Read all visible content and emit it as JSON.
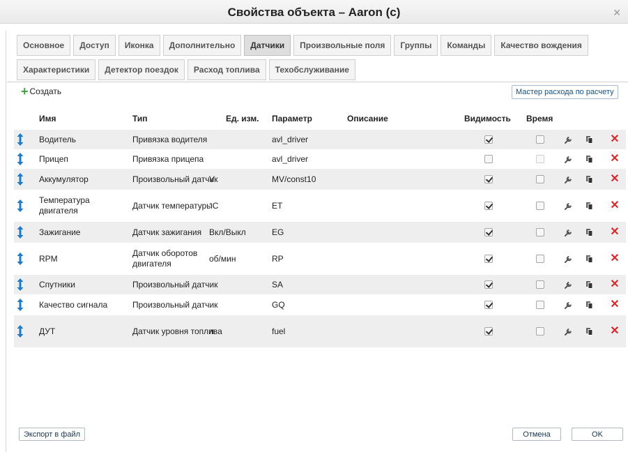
{
  "dialog": {
    "title": "Свойства объекта – Aaron (c)"
  },
  "tabs_row1": [
    "Основное",
    "Доступ",
    "Иконка",
    "Дополнительно",
    "Датчики",
    "Произвольные поля",
    "Группы",
    "Команды",
    "Качество вождения"
  ],
  "tabs_row2": [
    "Характеристики",
    "Детектор поездок",
    "Расход топлива",
    "Техобслуживание"
  ],
  "active_tab": "Датчики",
  "toolbar": {
    "create_label": "Создать",
    "wizard_label": "Мастер расхода по расчету"
  },
  "table": {
    "headers": {
      "name": "Имя",
      "type": "Тип",
      "unit": "Ед. изм.",
      "param": "Параметр",
      "desc": "Описание",
      "visibility": "Видимость",
      "time": "Время"
    },
    "rows": [
      {
        "name": "Водитель",
        "type": "Привязка водителя",
        "unit": "",
        "param": "avl_driver",
        "desc": "",
        "visible": true,
        "time": false,
        "time_disabled": false
      },
      {
        "name": "Прицеп",
        "type": "Привязка прицепа",
        "unit": "",
        "param": "avl_driver",
        "desc": "",
        "visible": false,
        "time": false,
        "time_disabled": true
      },
      {
        "name": "Аккумулятор",
        "type": "Произвольный датчик",
        "unit": "V",
        "param": "MV/const10",
        "desc": "",
        "visible": true,
        "time": false,
        "time_disabled": false
      },
      {
        "name": "Температура двигателя",
        "type": "Датчик температуры",
        "unit": "°C",
        "param": "ET",
        "desc": "",
        "visible": true,
        "time": false,
        "time_disabled": false
      },
      {
        "name": "Зажигание",
        "type": "Датчик зажигания",
        "unit": "Вкл/Выкл",
        "param": "EG",
        "desc": "",
        "visible": true,
        "time": false,
        "time_disabled": false
      },
      {
        "name": "RPM",
        "type": "Датчик оборотов двигателя",
        "unit": "об/мин",
        "param": "RP",
        "desc": "",
        "visible": true,
        "time": false,
        "time_disabled": false
      },
      {
        "name": "Спутники",
        "type": "Произвольный датчик",
        "unit": "",
        "param": "SA",
        "desc": "",
        "visible": true,
        "time": false,
        "time_disabled": false
      },
      {
        "name": "Качество сигнала",
        "type": "Произвольный датчик",
        "unit": "",
        "param": "GQ",
        "desc": "",
        "visible": true,
        "time": false,
        "time_disabled": false
      },
      {
        "name": "ДУТ",
        "type": "Датчик уровня топлива",
        "unit": "л",
        "param": "fuel",
        "desc": "",
        "visible": true,
        "time": false,
        "time_disabled": false
      }
    ]
  },
  "footer": {
    "export_label": "Экспорт в файл",
    "cancel_label": "Отмена",
    "ok_label": "OK"
  },
  "icons": {
    "handle": "drag-handle-icon",
    "wrench": "wrench-icon",
    "copy": "copy-icon",
    "delete": "delete-icon",
    "close": "close-icon"
  },
  "colors": {
    "accent_blue": "#1f7cc9",
    "delete_red": "#d52b2b",
    "create_green": "#3ea33e",
    "row_shade": "#eeeeee"
  }
}
